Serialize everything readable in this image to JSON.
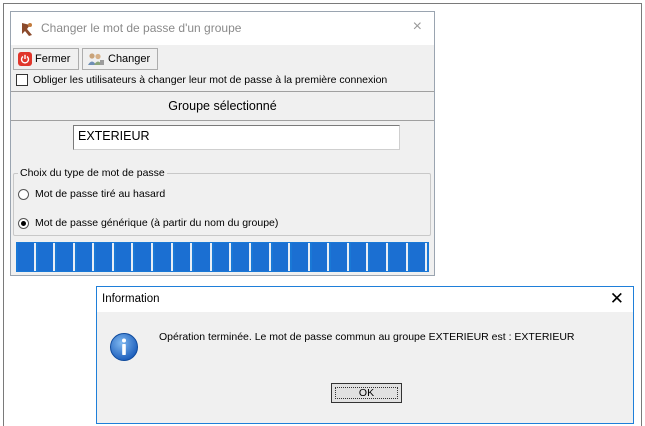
{
  "main_window": {
    "title": "Changer le mot de passe d'un groupe",
    "close_glyph": "×",
    "toolbar": {
      "fermer_label": "Fermer",
      "changer_label": "Changer"
    },
    "force_change_checkbox": {
      "label": "Obliger les utilisateurs à changer leur mot de passe à la première connexion",
      "checked": false
    },
    "group_header": "Groupe sélectionné",
    "group_value": "EXTERIEUR",
    "password_type": {
      "legend": "Choix du type de mot de passe",
      "options": [
        {
          "label": "Mot de passe tiré au hasard",
          "selected": false
        },
        {
          "label": "Mot de passe générique (à partir du  nom du groupe)",
          "selected": true
        }
      ]
    },
    "progress": {
      "fraction": 1.0,
      "segments": 21,
      "color": "#1b6fd2"
    }
  },
  "dialog": {
    "title": "Information",
    "close_glyph": "✕",
    "icon": "info-icon",
    "message": "Opération terminée. Le mot de passe commun au groupe EXTERIEUR est : EXTERIEUR",
    "ok_label": "OK",
    "accent_color": "#1f7fd9"
  }
}
